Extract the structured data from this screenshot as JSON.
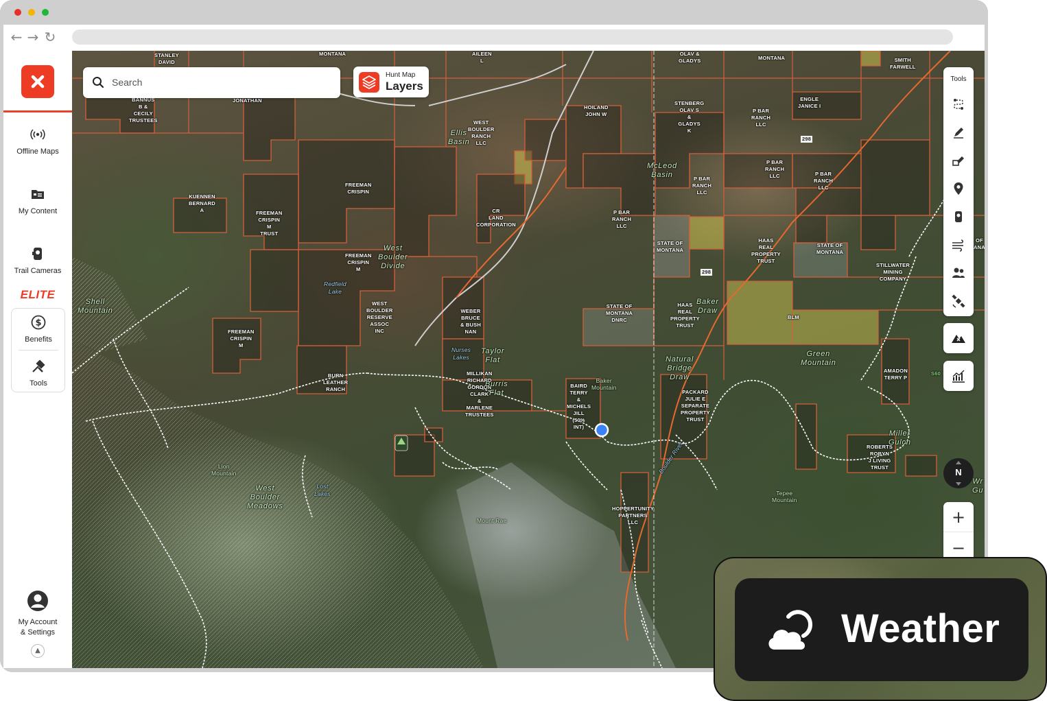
{
  "browser": {
    "back_icon": "back-arrow-icon",
    "forward_icon": "forward-arrow-icon",
    "reload_icon": "reload-icon"
  },
  "sidebar": {
    "offline_maps": "Offline Maps",
    "my_content": "My Content",
    "trail_cameras": "Trail Cameras",
    "elite": "ELITE",
    "benefits": "Benefits",
    "tools": "Tools",
    "account_line1": "My Account",
    "account_line2": "& Settings"
  },
  "search": {
    "placeholder": "Search"
  },
  "layers": {
    "small": "Hunt Map",
    "big": "Layers"
  },
  "tools_panel": {
    "title": "Tools"
  },
  "compass": {
    "label": "N"
  },
  "zoom": {
    "in": "+",
    "out": "−"
  },
  "weather": {
    "label": "Weather"
  },
  "colors": {
    "brand": "#ee3b24",
    "parcel_border": "#d4603a",
    "highlight_parcel": "#c8b84a",
    "location_dot": "#3b82f6"
  },
  "map_labels": {
    "l1": "STANLEY\nDAVID",
    "l2": "MONTANA",
    "l3": "AILEEN\nL",
    "l4": "OLAV &\nGLADYS",
    "l5": "MONTANA",
    "l6": "SMITH\nFARWELL",
    "l7": "BANNUS\nB &\nCECILY\nTRUSTEES",
    "l8": "JONATHAN",
    "l9": "HOILAND\nJOHN W",
    "l10": "STENBERG\nOLAV S\n&\nGLADYS\nK",
    "l11": "P BAR\nRANCH\nLLC",
    "l12": "ENGLE\nJANICE I",
    "l13": "WEST\nBOULDER\nRANCH\nLLC",
    "l14": "KUENNEN\nBERNARD\nA",
    "l15": "FREEMAN\nCRISPIN",
    "l16": "FREEMAN\nCRISPIN\nM\nTRUST",
    "l17": "CR\nLAND\nCORPORATION",
    "l18": "P BAR\nRANCH\nLLC",
    "l19": "P BAR\nRANCH\nLLC",
    "l20": "P BAR\nRANCH\nLLC",
    "l21": "P BAR\nRANCH\nLLC",
    "l22": "STATE OF\nMONTANA",
    "l23": "HAAS\nREAL\nPROPERTY\nTRUST",
    "l24": "STATE OF\nMONTANA",
    "l25": "STILLWATER\nMINING\nCOMPANY",
    "l26": "FREEMAN\nCRISPIN\nM",
    "l27": "WEST\nBOULDER\nRESERVE\nASSOC\nINC",
    "l28": "WEBER\nBRUCE\n& BUSH\nNAN",
    "l29": "STATE OF\nMONTANA\nDNRC",
    "l30": "HAAS\nREAL\nPROPERTY\nTRUST",
    "l31": "BLM",
    "l32": "FREEMAN\nCRISPIN\nM",
    "l33": "BURN\nLEATHER\nRANCH",
    "l34": "MILLIKAN\nRICHARD\nGORDON\nCLARK\n&\nMARLENE\nTRUSTEES",
    "l35": "BAIRD\nTERRY\n&\nMICHELS\nJILL\n(50%\nINT)",
    "l36": "PACKARD\nJULIE E\nSEPARATE\nPROPERTY\nTRUST",
    "l37": "AMADON\nTERRY P",
    "l38": "ROBERTS\nROBYN\nJ LIVING\nTRUST",
    "l39": "HOPPERTUNITY\nPARTNERS\nLLC",
    "p1": "Ellis\nBasin",
    "p2": "McLeod\nBasin",
    "p3": "West\nBoulder\nDivide",
    "p4": "Shell\nMountain",
    "p5": "Taylor\nFlat",
    "p6": "Burris\nFlat",
    "p7": "Baker\nDraw",
    "p8": "Natural\nBridge\nDraw",
    "p9": "Green\nMountain",
    "p10": "West\nBoulder\nMeadows",
    "p11": "Miller\nGulch",
    "w1": "Redfield\nLake",
    "w2": "Nurses\nLakes",
    "w3": "Lost\nLakes",
    "w4": "Boulder River",
    "k1": "Baker\nMountain",
    "k2": "Lion\nMountain",
    "k3": "Mount Rae",
    "k4": "Tepee\nMountain",
    "r1": "298",
    "r2": "298",
    "r3": "S60",
    "e1": "OF\nANA",
    "e2": "Wr\nGu"
  }
}
